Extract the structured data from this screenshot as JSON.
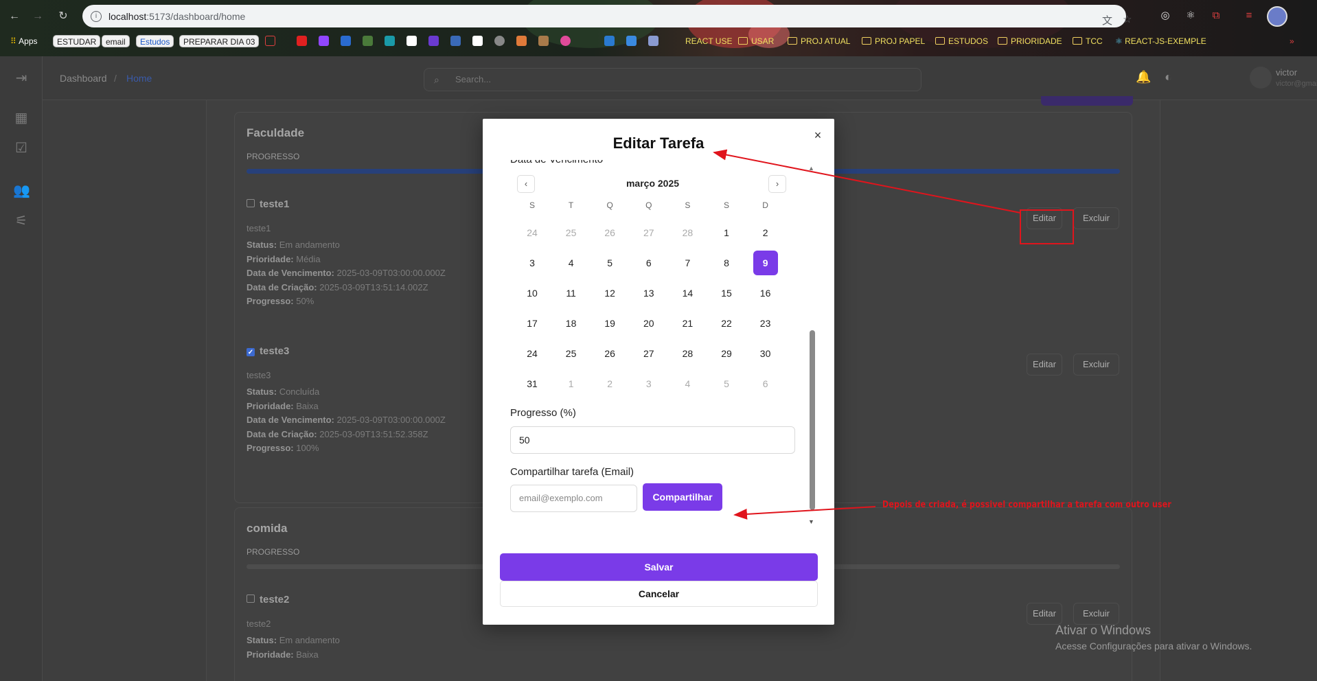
{
  "browser": {
    "url_host": "localhost",
    "url_path": ":5173/dashboard/home",
    "bookmarks": {
      "apps": "Apps",
      "pills": [
        "ESTUDAR",
        "email",
        "Estudos",
        "PREPARAR DIA 03"
      ],
      "folders": [
        "REACT USE",
        "USAR",
        "PROJ ATUAL",
        "PROJ PAPEL",
        "ESTUDOS",
        "PRIORIDADE",
        "TCC",
        "REACT-JS-EXEMPLE"
      ]
    }
  },
  "app": {
    "breadcrumb": [
      "Dashboard",
      "Home"
    ],
    "breadcrumb_sep": "/",
    "search_placeholder": "Search...",
    "user": {
      "name": "victor",
      "email": "victor@gmail.com"
    }
  },
  "cards": [
    {
      "title": "Faculdade",
      "progress_label": "PROGRESSO",
      "progress_fraction": 1.0,
      "tasks": [
        {
          "title": "teste1",
          "checked": false,
          "description": "teste1",
          "status_label": "Status:",
          "status": "Em andamento",
          "priority_label": "Prioridade:",
          "priority": "Média",
          "due_label": "Data de Vencimento:",
          "due": "2025-03-09T03:00:00.000Z",
          "created_label": "Data de Criação:",
          "created": "2025-03-09T13:51:14.002Z",
          "progress_label": "Progresso:",
          "progress": "50%",
          "edit": "Editar",
          "delete": "Excluir"
        },
        {
          "title": "teste3",
          "checked": true,
          "description": "teste3",
          "status_label": "Status:",
          "status": "Concluída",
          "priority_label": "Prioridade:",
          "priority": "Baixa",
          "due_label": "Data de Vencimento:",
          "due": "2025-03-09T03:00:00.000Z",
          "created_label": "Data de Criação:",
          "created": "2025-03-09T13:51:52.358Z",
          "progress_label": "Progresso:",
          "progress": "100%",
          "edit": "Editar",
          "delete": "Excluir"
        }
      ]
    },
    {
      "title": "comida",
      "progress_label": "PROGRESSO",
      "progress_fraction": 0,
      "tasks": [
        {
          "title": "teste2",
          "checked": false,
          "description": "teste2",
          "status_label": "Status:",
          "status": "Em andamento",
          "priority_label": "Prioridade:",
          "priority": "Baixa",
          "edit": "Editar",
          "delete": "Excluir"
        }
      ]
    }
  ],
  "modal": {
    "title": "Editar Tarefa",
    "close": "×",
    "due_label": "Data de Vencimento",
    "calendar": {
      "month": "março 2025",
      "prev": "‹",
      "next": "›",
      "weekdays": [
        "S",
        "T",
        "Q",
        "Q",
        "S",
        "S",
        "D"
      ],
      "weeks": [
        [
          "24",
          "25",
          "26",
          "27",
          "28",
          "1",
          "2"
        ],
        [
          "3",
          "4",
          "5",
          "6",
          "7",
          "8",
          "9"
        ],
        [
          "10",
          "11",
          "12",
          "13",
          "14",
          "15",
          "16"
        ],
        [
          "17",
          "18",
          "19",
          "20",
          "21",
          "22",
          "23"
        ],
        [
          "24",
          "25",
          "26",
          "27",
          "28",
          "29",
          "30"
        ],
        [
          "31",
          "1",
          "2",
          "3",
          "4",
          "5",
          "6"
        ]
      ],
      "selected_day": "9"
    },
    "progress_label": "Progresso (%)",
    "progress_value": "50",
    "share_label": "Compartilhar tarefa (Email)",
    "email_placeholder": "email@exemplo.com",
    "share_button": "Compartilhar",
    "save_button": "Salvar",
    "cancel_button": "Cancelar"
  },
  "annotation": {
    "text": "Depois de criada, é possivel compartilhar a tarefa com outro user",
    "color": "#e0141c"
  },
  "watermark": {
    "line1": "Ativar o Windows",
    "line2": "Acesse Configurações para ativar o Windows."
  },
  "colors": {
    "accent": "#7a3be8"
  }
}
